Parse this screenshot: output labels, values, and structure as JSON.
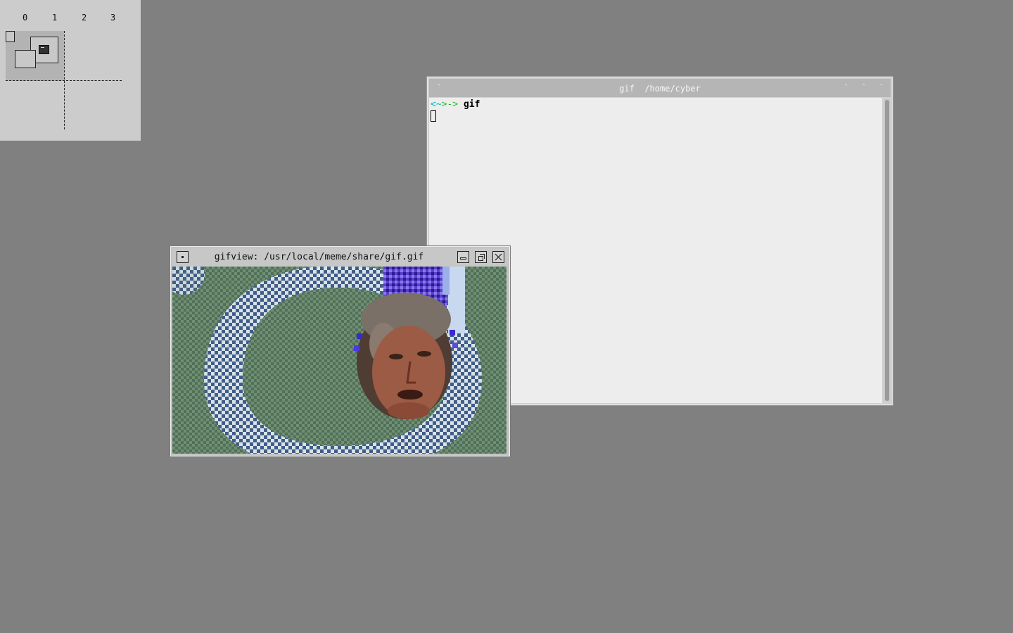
{
  "pager": {
    "desktops": [
      "0",
      "1",
      "2",
      "3"
    ],
    "active_desktop": "0"
  },
  "terminal": {
    "title": "gif  /home/cyber",
    "prompt_open": "<",
    "prompt_tilde": "~",
    "prompt_arrow": ">->",
    "command": "gif",
    "colors": {
      "prompt_cyan": "#00b5b5",
      "prompt_green": "#22bb22"
    }
  },
  "gifview": {
    "title": "gifview: /usr/local/meme/share/gif.gif",
    "image_description_icon": "animated-gif-frame"
  },
  "colors": {
    "desktop": "#808080",
    "pager": "#cccccc"
  }
}
